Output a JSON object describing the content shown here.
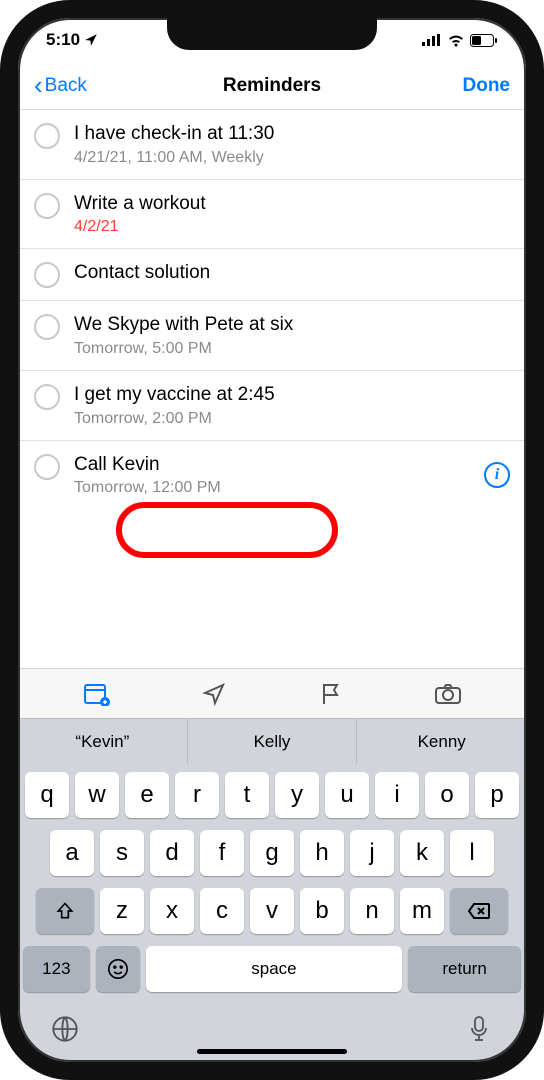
{
  "status": {
    "time": "5:10",
    "loc_icon": "location-arrow"
  },
  "nav": {
    "back": "Back",
    "title": "Reminders",
    "done": "Done"
  },
  "reminders": [
    {
      "title": "I have check-in at 11:30",
      "sub": "4/21/21, 11:00 AM, Weekly",
      "overdue": false,
      "info": false
    },
    {
      "title": "Write a workout",
      "sub": "4/2/21",
      "overdue": true,
      "info": false
    },
    {
      "title": "Contact solution",
      "sub": "",
      "overdue": false,
      "info": false
    },
    {
      "title": "We Skype with Pete at six",
      "sub": "Tomorrow, 5:00 PM",
      "overdue": false,
      "info": false
    },
    {
      "title": "I get my vaccine at 2:45",
      "sub": "Tomorrow, 2:00 PM",
      "overdue": false,
      "info": false
    },
    {
      "title": "Call Kevin",
      "sub": "Tomorrow, 12:00 PM",
      "overdue": false,
      "info": true
    }
  ],
  "suggestions": [
    "“Kevin”",
    "Kelly",
    "Kenny"
  ],
  "keyboard": {
    "row1": [
      "q",
      "w",
      "e",
      "r",
      "t",
      "y",
      "u",
      "i",
      "o",
      "p"
    ],
    "row2": [
      "a",
      "s",
      "d",
      "f",
      "g",
      "h",
      "j",
      "k",
      "l"
    ],
    "row3": [
      "z",
      "x",
      "c",
      "v",
      "b",
      "n",
      "m"
    ],
    "num": "123",
    "space": "space",
    "return": "return"
  }
}
